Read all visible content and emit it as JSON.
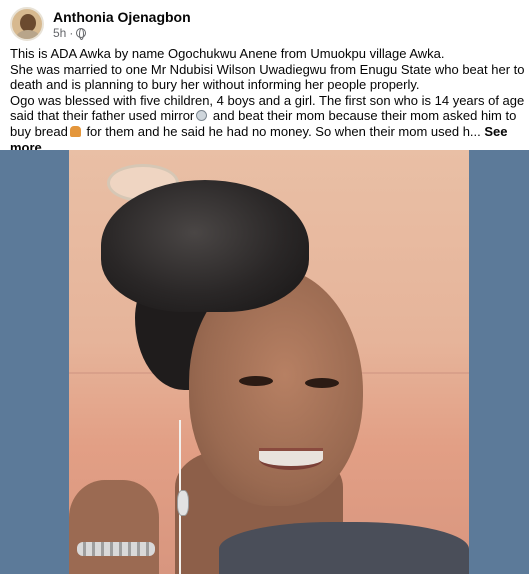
{
  "post": {
    "author": "Anthonia Ojenagbon",
    "time": "5h",
    "separator": "·",
    "privacy_icon": "globe-icon",
    "text": {
      "p1": "This is ADA Awka by name Ogochukwu Anene from Umuokpu village Awka.",
      "p2": "She was married to one Mr Ndubisi Wilson Uwadiegwu  from Enugu State who beat her to death and is planning to bury her without informing her people properly.",
      "p3_part1": "Ogo was blessed with five children, 4 boys and a girl. The first son who is 14 years of age said that their father used mirror",
      "p3_emoji1": "mirror-icon",
      "p3_part2": " and beat their mom because their mom asked him to buy bread",
      "p3_emoji2": "bread-icon",
      "p3_part3": " for them and he said he had no money. So when their mom used h... ",
      "see_more": "See more"
    }
  },
  "photo": {
    "background_color": "#5c7a99"
  }
}
